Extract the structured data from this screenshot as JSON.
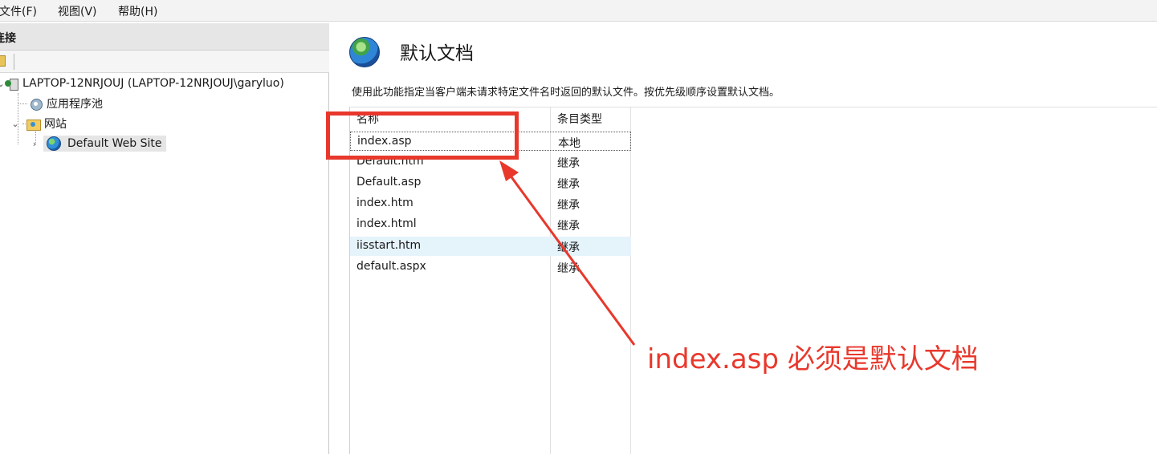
{
  "menubar": {
    "items": [
      "文件(F)",
      "视图(V)",
      "帮助(H)"
    ]
  },
  "left_pane": {
    "header": "连接",
    "tree": [
      {
        "label": "LAPTOP-12NRJOUJ (LAPTOP-12NRJOUJ\\garyluo)",
        "icon": "server-icon"
      },
      {
        "label": "应用程序池",
        "icon": "app-pool-icon"
      },
      {
        "label": "网站",
        "icon": "sites-folder-icon"
      },
      {
        "label": "Default Web Site",
        "icon": "globe-icon",
        "selected": true
      }
    ]
  },
  "main": {
    "title": "默认文档",
    "description": "使用此功能指定当客户端未请求特定文件名时返回的默认文件。按优先级顺序设置默认文档。",
    "columns": [
      "名称",
      "条目类型"
    ],
    "rows": [
      {
        "name": "index.asp",
        "type": "本地"
      },
      {
        "name": "Default.htm",
        "type": "继承"
      },
      {
        "name": "Default.asp",
        "type": "继承"
      },
      {
        "name": "index.htm",
        "type": "继承"
      },
      {
        "name": "index.html",
        "type": "继承"
      },
      {
        "name": "iisstart.htm",
        "type": "继承"
      },
      {
        "name": "default.aspx",
        "type": "继承"
      }
    ]
  },
  "annotation": {
    "text": "index.asp 必须是默认文档",
    "color": "#e8382c"
  }
}
